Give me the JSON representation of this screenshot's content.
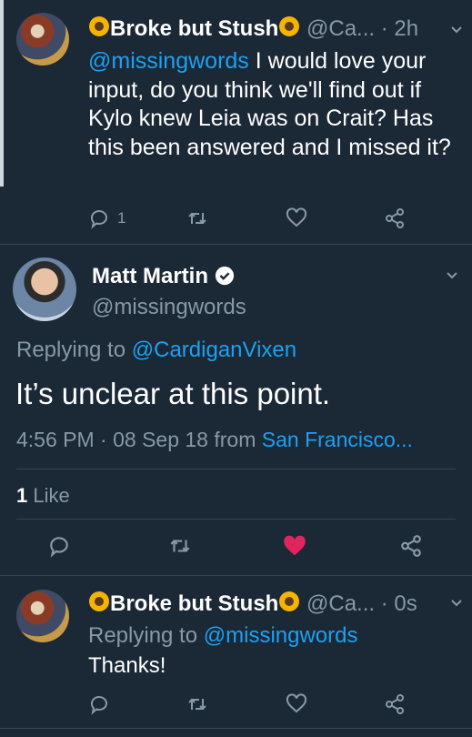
{
  "tweet1": {
    "name": "Broke but Stush",
    "handle": "@Ca...",
    "time": "· 2h",
    "mention": "@missingwords",
    "text": " I would love your input, do you think we'll find out if Kylo knew Leia was on Crait? Has this been answered and I missed it?",
    "reply_count": "1"
  },
  "main": {
    "name": "Matt Martin",
    "handle": "@missingwords",
    "replying_prefix": "Replying to ",
    "replying_to": "@CardiganVixen",
    "text": "It’s unclear at this point.",
    "timestamp": "4:56 PM · 08 Sep 18 from ",
    "location": "San Francisco...",
    "likes_count": "1",
    "likes_label": "Like"
  },
  "tweet3": {
    "name": "Broke but Stush",
    "handle": "@Ca...",
    "time": "· 0s",
    "replying_prefix": "Replying to ",
    "replying_to": "@missingwords",
    "text": "Thanks!"
  },
  "icons": [
    "sunflower-icon",
    "verified-badge-icon",
    "chevron-down-icon",
    "reply-icon",
    "retweet-icon",
    "heart-icon",
    "share-icon"
  ],
  "colors": {
    "background": "#1b2836",
    "link": "#1da1f2",
    "muted": "#8899a6",
    "liked": "#e0245e",
    "divider": "#38444d"
  }
}
